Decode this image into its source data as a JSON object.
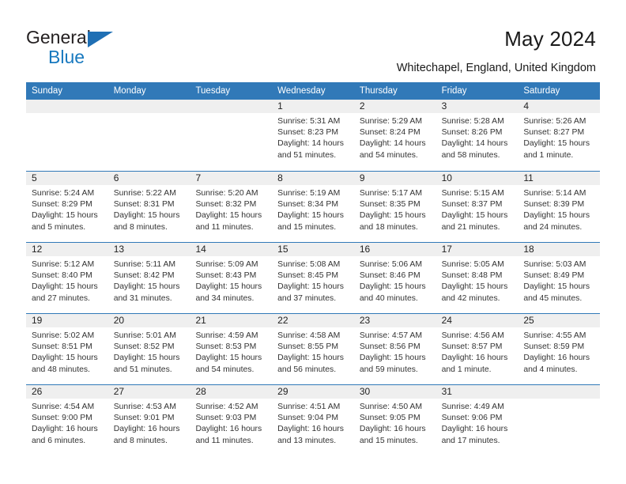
{
  "brand": {
    "line1": "General",
    "line2": "Blue",
    "accent_color": "#1879bf"
  },
  "header": {
    "title": "May 2024",
    "location": "Whitechapel, England, United Kingdom",
    "header_bg_color": "#3179b8"
  },
  "calendar": {
    "weekday_headers": [
      "Sunday",
      "Monday",
      "Tuesday",
      "Wednesday",
      "Thursday",
      "Friday",
      "Saturday"
    ],
    "weeks": [
      [
        {
          "day": "",
          "empty": true
        },
        {
          "day": "",
          "empty": true
        },
        {
          "day": "",
          "empty": true
        },
        {
          "day": "1",
          "sunrise": "Sunrise: 5:31 AM",
          "sunset": "Sunset: 8:23 PM",
          "daylight1": "Daylight: 14 hours",
          "daylight2": "and 51 minutes."
        },
        {
          "day": "2",
          "sunrise": "Sunrise: 5:29 AM",
          "sunset": "Sunset: 8:24 PM",
          "daylight1": "Daylight: 14 hours",
          "daylight2": "and 54 minutes."
        },
        {
          "day": "3",
          "sunrise": "Sunrise: 5:28 AM",
          "sunset": "Sunset: 8:26 PM",
          "daylight1": "Daylight: 14 hours",
          "daylight2": "and 58 minutes."
        },
        {
          "day": "4",
          "sunrise": "Sunrise: 5:26 AM",
          "sunset": "Sunset: 8:27 PM",
          "daylight1": "Daylight: 15 hours",
          "daylight2": "and 1 minute."
        }
      ],
      [
        {
          "day": "5",
          "sunrise": "Sunrise: 5:24 AM",
          "sunset": "Sunset: 8:29 PM",
          "daylight1": "Daylight: 15 hours",
          "daylight2": "and 5 minutes."
        },
        {
          "day": "6",
          "sunrise": "Sunrise: 5:22 AM",
          "sunset": "Sunset: 8:31 PM",
          "daylight1": "Daylight: 15 hours",
          "daylight2": "and 8 minutes."
        },
        {
          "day": "7",
          "sunrise": "Sunrise: 5:20 AM",
          "sunset": "Sunset: 8:32 PM",
          "daylight1": "Daylight: 15 hours",
          "daylight2": "and 11 minutes."
        },
        {
          "day": "8",
          "sunrise": "Sunrise: 5:19 AM",
          "sunset": "Sunset: 8:34 PM",
          "daylight1": "Daylight: 15 hours",
          "daylight2": "and 15 minutes."
        },
        {
          "day": "9",
          "sunrise": "Sunrise: 5:17 AM",
          "sunset": "Sunset: 8:35 PM",
          "daylight1": "Daylight: 15 hours",
          "daylight2": "and 18 minutes."
        },
        {
          "day": "10",
          "sunrise": "Sunrise: 5:15 AM",
          "sunset": "Sunset: 8:37 PM",
          "daylight1": "Daylight: 15 hours",
          "daylight2": "and 21 minutes."
        },
        {
          "day": "11",
          "sunrise": "Sunrise: 5:14 AM",
          "sunset": "Sunset: 8:39 PM",
          "daylight1": "Daylight: 15 hours",
          "daylight2": "and 24 minutes."
        }
      ],
      [
        {
          "day": "12",
          "sunrise": "Sunrise: 5:12 AM",
          "sunset": "Sunset: 8:40 PM",
          "daylight1": "Daylight: 15 hours",
          "daylight2": "and 27 minutes."
        },
        {
          "day": "13",
          "sunrise": "Sunrise: 5:11 AM",
          "sunset": "Sunset: 8:42 PM",
          "daylight1": "Daylight: 15 hours",
          "daylight2": "and 31 minutes."
        },
        {
          "day": "14",
          "sunrise": "Sunrise: 5:09 AM",
          "sunset": "Sunset: 8:43 PM",
          "daylight1": "Daylight: 15 hours",
          "daylight2": "and 34 minutes."
        },
        {
          "day": "15",
          "sunrise": "Sunrise: 5:08 AM",
          "sunset": "Sunset: 8:45 PM",
          "daylight1": "Daylight: 15 hours",
          "daylight2": "and 37 minutes."
        },
        {
          "day": "16",
          "sunrise": "Sunrise: 5:06 AM",
          "sunset": "Sunset: 8:46 PM",
          "daylight1": "Daylight: 15 hours",
          "daylight2": "and 40 minutes."
        },
        {
          "day": "17",
          "sunrise": "Sunrise: 5:05 AM",
          "sunset": "Sunset: 8:48 PM",
          "daylight1": "Daylight: 15 hours",
          "daylight2": "and 42 minutes."
        },
        {
          "day": "18",
          "sunrise": "Sunrise: 5:03 AM",
          "sunset": "Sunset: 8:49 PM",
          "daylight1": "Daylight: 15 hours",
          "daylight2": "and 45 minutes."
        }
      ],
      [
        {
          "day": "19",
          "sunrise": "Sunrise: 5:02 AM",
          "sunset": "Sunset: 8:51 PM",
          "daylight1": "Daylight: 15 hours",
          "daylight2": "and 48 minutes."
        },
        {
          "day": "20",
          "sunrise": "Sunrise: 5:01 AM",
          "sunset": "Sunset: 8:52 PM",
          "daylight1": "Daylight: 15 hours",
          "daylight2": "and 51 minutes."
        },
        {
          "day": "21",
          "sunrise": "Sunrise: 4:59 AM",
          "sunset": "Sunset: 8:53 PM",
          "daylight1": "Daylight: 15 hours",
          "daylight2": "and 54 minutes."
        },
        {
          "day": "22",
          "sunrise": "Sunrise: 4:58 AM",
          "sunset": "Sunset: 8:55 PM",
          "daylight1": "Daylight: 15 hours",
          "daylight2": "and 56 minutes."
        },
        {
          "day": "23",
          "sunrise": "Sunrise: 4:57 AM",
          "sunset": "Sunset: 8:56 PM",
          "daylight1": "Daylight: 15 hours",
          "daylight2": "and 59 minutes."
        },
        {
          "day": "24",
          "sunrise": "Sunrise: 4:56 AM",
          "sunset": "Sunset: 8:57 PM",
          "daylight1": "Daylight: 16 hours",
          "daylight2": "and 1 minute."
        },
        {
          "day": "25",
          "sunrise": "Sunrise: 4:55 AM",
          "sunset": "Sunset: 8:59 PM",
          "daylight1": "Daylight: 16 hours",
          "daylight2": "and 4 minutes."
        }
      ],
      [
        {
          "day": "26",
          "sunrise": "Sunrise: 4:54 AM",
          "sunset": "Sunset: 9:00 PM",
          "daylight1": "Daylight: 16 hours",
          "daylight2": "and 6 minutes."
        },
        {
          "day": "27",
          "sunrise": "Sunrise: 4:53 AM",
          "sunset": "Sunset: 9:01 PM",
          "daylight1": "Daylight: 16 hours",
          "daylight2": "and 8 minutes."
        },
        {
          "day": "28",
          "sunrise": "Sunrise: 4:52 AM",
          "sunset": "Sunset: 9:03 PM",
          "daylight1": "Daylight: 16 hours",
          "daylight2": "and 11 minutes."
        },
        {
          "day": "29",
          "sunrise": "Sunrise: 4:51 AM",
          "sunset": "Sunset: 9:04 PM",
          "daylight1": "Daylight: 16 hours",
          "daylight2": "and 13 minutes."
        },
        {
          "day": "30",
          "sunrise": "Sunrise: 4:50 AM",
          "sunset": "Sunset: 9:05 PM",
          "daylight1": "Daylight: 16 hours",
          "daylight2": "and 15 minutes."
        },
        {
          "day": "31",
          "sunrise": "Sunrise: 4:49 AM",
          "sunset": "Sunset: 9:06 PM",
          "daylight1": "Daylight: 16 hours",
          "daylight2": "and 17 minutes."
        },
        {
          "day": "",
          "empty": true
        }
      ]
    ]
  }
}
